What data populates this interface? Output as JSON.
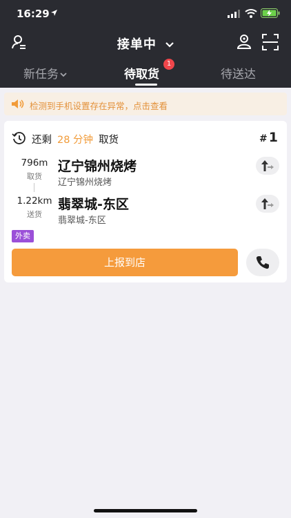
{
  "status_bar": {
    "time": "16:29"
  },
  "header": {
    "title": "接单中",
    "tabs": [
      {
        "label": "新任务"
      },
      {
        "label": "待取货",
        "badge": "1"
      },
      {
        "label": "待送达"
      }
    ],
    "active_tab": 1
  },
  "notice": {
    "text": "检测到手机设置存在异常，点击查看"
  },
  "order": {
    "remain_prefix": "还剩",
    "remain_time": "28 分钟",
    "remain_suffix": "取货",
    "number_hash": "#",
    "number": "1",
    "pickup": {
      "distance": "796m",
      "label": "取货",
      "name": "辽宁锦州烧烤",
      "address": "辽宁锦州烧烤"
    },
    "delivery": {
      "distance": "1.22km",
      "label": "送货",
      "name": "翡翠城-东区",
      "address": "翡翠城-东区"
    },
    "tag": "外卖",
    "action_label": "上报到店"
  },
  "colors": {
    "header_bg": "#2a2b31",
    "accent": "#f59b3c",
    "badge": "#f0464b",
    "tag": "#9b50d8",
    "notice_text": "#e3913a"
  }
}
